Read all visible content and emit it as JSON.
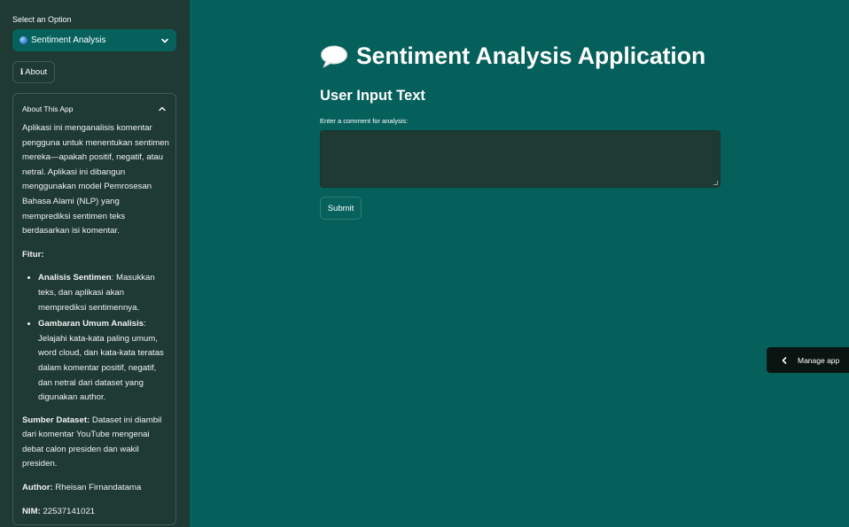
{
  "sidebar": {
    "select_label": "Select an Option",
    "select_value": "Sentiment Analysis",
    "about_button": "About",
    "about_button_glyph": "ℹ",
    "expander": {
      "title": "About This App",
      "intro": "Aplikasi ini menganalisis komentar pengguna untuk menentukan sentimen mereka—apakah positif, negatif, atau netral. Aplikasi ini dibangun menggunakan model Pemrosesan Bahasa Alami (NLP) yang memprediksi sentimen teks berdasarkan isi komentar.",
      "features_heading": "Fitur:",
      "features": [
        {
          "name": "Analisis Sentimen",
          "desc": "Masukkan teks, dan aplikasi akan memprediksi sentimennya."
        },
        {
          "name": "Gambaran Umum Analisis",
          "desc": "Jelajahi kata-kata paling umum, word cloud, dan kata-kata teratas dalam komentar positif, negatif, dan netral dari dataset yang digunakan author."
        }
      ],
      "dataset_label": "Sumber Dataset:",
      "dataset_text": "Dataset ini diambil dari komentar YouTube mengenai debat calon presiden dan wakil presiden.",
      "author_label": "Author:",
      "author_value": "Rheisan Firnandatama",
      "nim_label": "NIM:",
      "nim_value": "22537141021"
    }
  },
  "main": {
    "title": "Sentiment Analysis Application",
    "subheading": "User Input Text",
    "input_label": "Enter a comment for analysis:",
    "input_value": "",
    "submit_label": "Submit"
  },
  "manage_app": {
    "label": "Manage app"
  },
  "icons": {
    "select_icon": "globe-icon",
    "title_icon": "speech-bubble-icon"
  },
  "colors": {
    "main_bg": "#055f5b",
    "sidebar_bg": "#1e3a33",
    "accent": "#06615d",
    "manage_bg": "#0a1410"
  }
}
